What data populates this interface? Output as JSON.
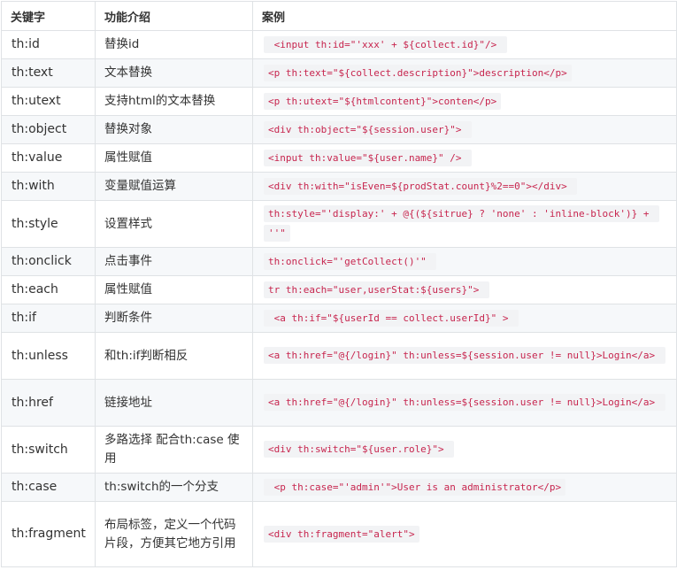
{
  "table": {
    "headers": [
      "关键字",
      "功能介绍",
      "案例"
    ],
    "rows": [
      {
        "keyword": "th:id",
        "description": "替换id",
        "example": " <input th:id=\"'xxx' + ${collect.id}\"/> "
      },
      {
        "keyword": "th:text",
        "description": "文本替换",
        "example": "<p th:text=\"${collect.description}\">description</p>"
      },
      {
        "keyword": "th:utext",
        "description": "支持html的文本替换",
        "example": "<p th:utext=\"${htmlcontent}\">conten</p>"
      },
      {
        "keyword": "th:object",
        "description": "替换对象",
        "example": "<div th:object=\"${session.user}\"> "
      },
      {
        "keyword": "th:value",
        "description": "属性赋值",
        "example": "<input th:value=\"${user.name}\" /> "
      },
      {
        "keyword": "th:with",
        "description": "变量赋值运算",
        "example": "<div th:with=\"isEven=${prodStat.count}%2==0\"></div> "
      },
      {
        "keyword": "th:style",
        "description": "设置样式",
        "example": "th:style=\"'display:' + @{(${sitrue} ? 'none' : 'inline-block')} + ''\""
      },
      {
        "keyword": "th:onclick",
        "description": "点击事件",
        "example": "th:onclick=\"'getCollect()'\" "
      },
      {
        "keyword": "th:each",
        "description": "属性赋值",
        "example": "tr th:each=\"user,userStat:${users}\"> "
      },
      {
        "keyword": "th:if",
        "description": "判断条件",
        "example": " <a th:if=\"${userId == collect.userId}\" > "
      },
      {
        "keyword": "th:unless",
        "description": "和th:if判断相反",
        "example": "<a th:href=\"@{/login}\" th:unless=${session.user != null}>Login</a> "
      },
      {
        "keyword": "th:href",
        "description": "链接地址",
        "example": "<a th:href=\"@{/login}\" th:unless=${session.user != null}>Login</a> "
      },
      {
        "keyword": "th:switch",
        "description": "多路选择 配合th:case 使用",
        "example": "<div th:switch=\"${user.role}\"> "
      },
      {
        "keyword": "th:case",
        "description": "th:switch的一个分支",
        "example": " <p th:case=\"'admin'\">User is an administrator</p>"
      },
      {
        "keyword": "th:fragment",
        "description": "布局标签，定义一个代码片段，方便其它地方引用",
        "example": "<div th:fragment=\"alert\">"
      }
    ]
  }
}
